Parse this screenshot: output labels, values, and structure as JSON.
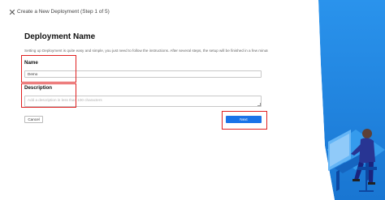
{
  "header": {
    "close_icon": "close-icon",
    "step_title": "Create a New Deployment (Step 1 of 5)"
  },
  "page": {
    "title": "Deployment Name",
    "intro": "Setting up Deployment is quite easy and simple, you just need to follow the instructions. After several steps, the setup will be finished in a few minutes."
  },
  "form": {
    "name_label": "Name",
    "name_value": "Demo",
    "description_label": "Description",
    "description_placeholder": "Add a description in less than 100 characters"
  },
  "actions": {
    "cancel_label": "Cancel",
    "next_label": "Next"
  },
  "colors": {
    "primary": "#1a73e8",
    "highlight": "#e02020",
    "panel_blue": "#1e88e5"
  }
}
